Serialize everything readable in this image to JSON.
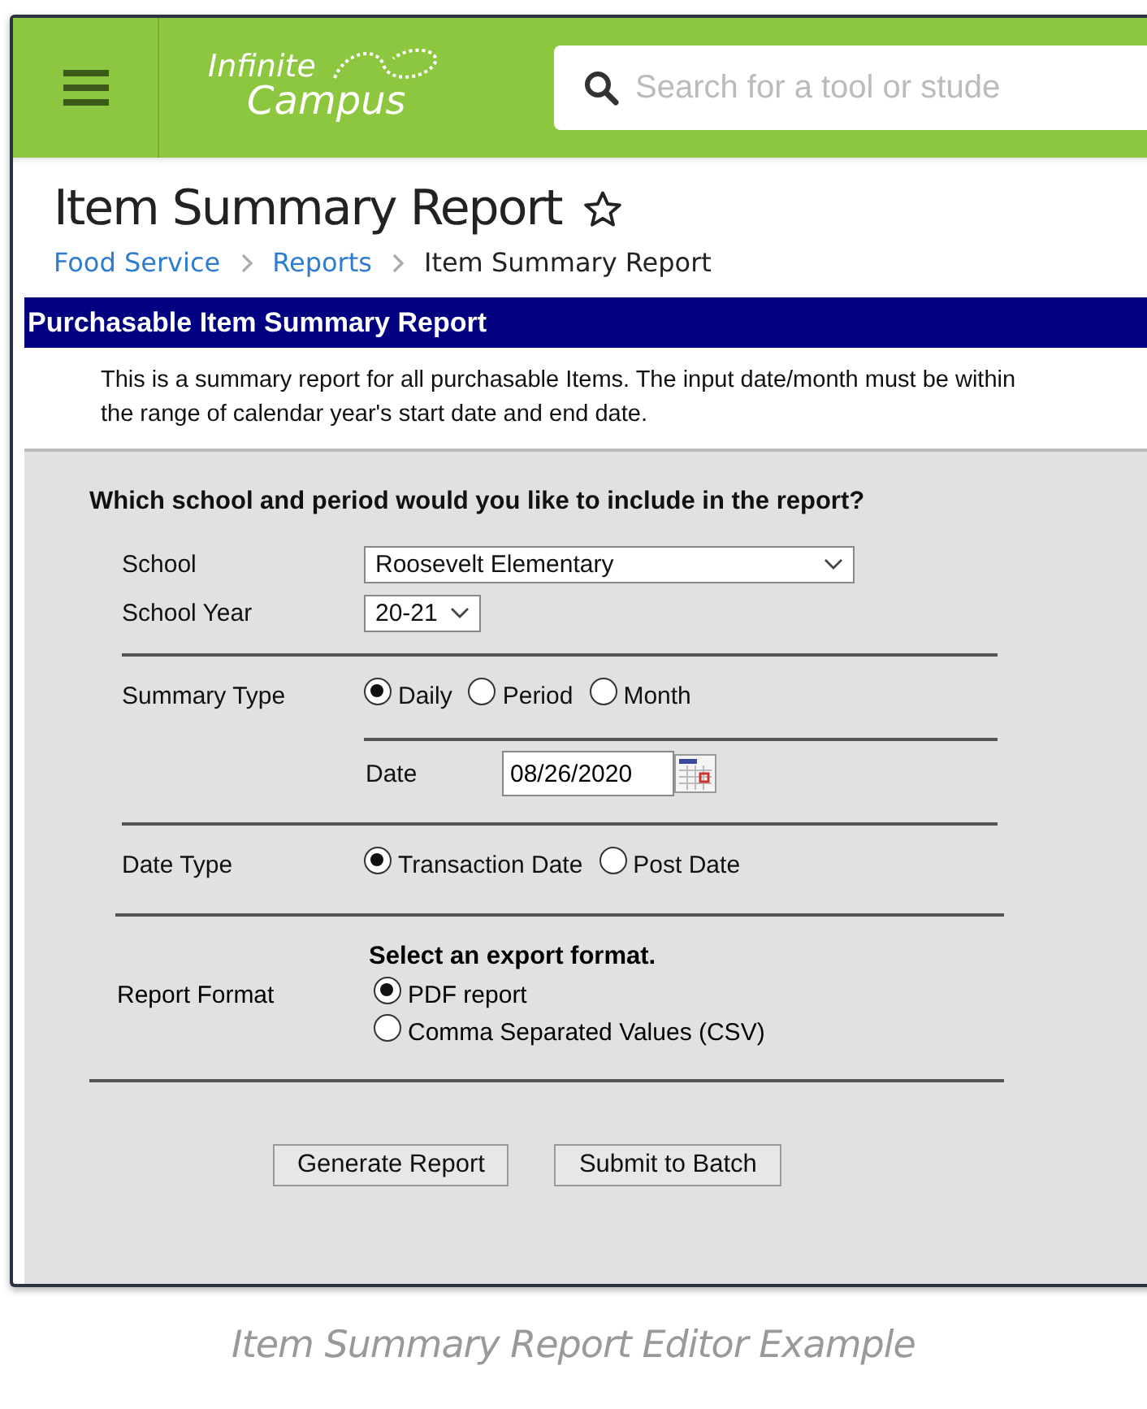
{
  "header": {
    "logo": {
      "line1": "Infinite",
      "line2": "Campus"
    },
    "search": {
      "placeholder": "Search for a tool or stude"
    }
  },
  "page": {
    "title": "Item Summary Report",
    "favorite": false,
    "breadcrumbs": [
      {
        "label": "Food Service",
        "link": true
      },
      {
        "label": "Reports",
        "link": true
      },
      {
        "label": "Item Summary Report",
        "link": false
      }
    ]
  },
  "report": {
    "title": "Purchasable Item Summary Report",
    "description": "This is a summary report for all purchasable Items. The input date/month must be within the range of calendar year's start date and end date.",
    "question": "Which school and period would you like to include in the report?",
    "school": {
      "label": "School",
      "value": "Roosevelt Elementary"
    },
    "school_year": {
      "label": "School Year",
      "value": "20-21"
    },
    "summary_type": {
      "label": "Summary Type",
      "options": [
        {
          "label": "Daily",
          "selected": true
        },
        {
          "label": "Period",
          "selected": false
        },
        {
          "label": "Month",
          "selected": false
        }
      ]
    },
    "date": {
      "label": "Date",
      "value": "08/26/2020"
    },
    "date_type": {
      "label": "Date Type",
      "options": [
        {
          "label": "Transaction Date",
          "selected": true
        },
        {
          "label": "Post Date",
          "selected": false
        }
      ]
    },
    "report_format": {
      "label": "Report Format",
      "heading": "Select an export format.",
      "options": [
        {
          "label": "PDF report",
          "selected": true
        },
        {
          "label": "Comma Separated Values (CSV)",
          "selected": false
        }
      ]
    },
    "buttons": [
      "Generate Report",
      "Submit to Batch"
    ]
  },
  "caption": "Item Summary Report Editor Example"
}
